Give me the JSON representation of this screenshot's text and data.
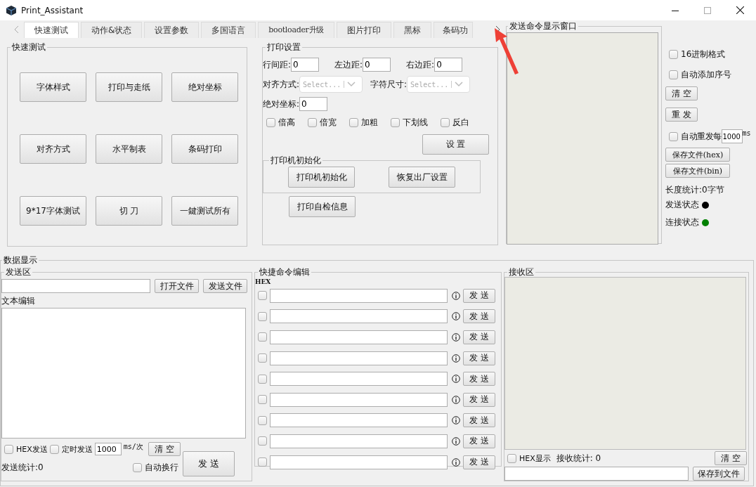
{
  "window": {
    "title": "Print_Assistant"
  },
  "tabs": [
    {
      "label": "快速测试",
      "selected": true
    },
    {
      "label": "动作&状态",
      "selected": false
    },
    {
      "label": "设置参数",
      "selected": false
    },
    {
      "label": "多国语言",
      "selected": false
    },
    {
      "label": "bootloader升级",
      "selected": false
    },
    {
      "label": "图片打印",
      "selected": false
    },
    {
      "label": "黑标",
      "selected": false
    },
    {
      "label": "条码功",
      "selected": false
    }
  ],
  "quick_test": {
    "title": "快速测试",
    "buttons": [
      "字体样式",
      "打印与走纸",
      "绝对坐标",
      "对齐方式",
      "水平制表",
      "条码打印",
      "9*17字体测试",
      "切 刀",
      "一鍵测试所有"
    ]
  },
  "print_settings": {
    "title": "打印设置",
    "margins": [
      {
        "label": "行间距:",
        "value": "0"
      },
      {
        "label": "左边距:",
        "value": "0"
      },
      {
        "label": "右边距:",
        "value": "0"
      }
    ],
    "selects": [
      {
        "label": "对齐方式:",
        "placeholder": "Select..."
      },
      {
        "label": "字符尺寸:",
        "placeholder": "Select..."
      }
    ],
    "abs_position": {
      "label": "绝对坐标:",
      "value": "0"
    },
    "options": [
      {
        "label": "倍高",
        "checked": false
      },
      {
        "label": "倍宽",
        "checked": false
      },
      {
        "label": "加粗",
        "checked": false
      },
      {
        "label": "下划线",
        "checked": false
      },
      {
        "label": "反白",
        "checked": false
      }
    ],
    "set_button": "设 置",
    "init_group": {
      "title": "打印机初始化",
      "buttons": [
        "打印机初始化",
        "恢复出厂设置"
      ]
    },
    "self_test_button": "打印自检信息"
  },
  "command_window": {
    "title": "发送命令显示窗口"
  },
  "command_options": {
    "checkboxes": [
      {
        "label": "16进制格式",
        "checked": false
      },
      {
        "label": "自动添加序号",
        "checked": false
      }
    ],
    "clear_button": "清 空",
    "resend_button": "重 发",
    "auto_resend": {
      "label": "自动重发每",
      "checked": false,
      "value": "1000",
      "unit": "ms"
    },
    "save_buttons": [
      "保存文件(hex)",
      "保存文件(bin)"
    ],
    "length_stat": "长度统计:0字节",
    "statuses": [
      {
        "label": "发送状态",
        "color": "#000000"
      },
      {
        "label": "连接状态",
        "color": "#008000"
      }
    ]
  },
  "data_display": {
    "title": "数据显示",
    "send_area": {
      "title": "发送区",
      "open_button": "打开文件",
      "send_file_button": "发送文件",
      "editor_label": "文本编辑",
      "hex_send": {
        "label": "HEX发送",
        "checked": false
      },
      "timed_send": {
        "label": "定时发送",
        "checked": false,
        "value": "1000",
        "unit": "ms/次"
      },
      "clear_button": "清 空",
      "send_button": "发 送",
      "send_stat": "发送统计:0",
      "auto_wrap": {
        "label": "自动换行",
        "checked": false
      }
    },
    "quick_commands": {
      "title": "快捷命令编辑",
      "hex_header": "HEX",
      "rows": [
        {
          "checked": false,
          "button": "发 送"
        },
        {
          "checked": false,
          "button": "发 送"
        },
        {
          "checked": false,
          "button": "发 送"
        },
        {
          "checked": false,
          "button": "发 送"
        },
        {
          "checked": false,
          "button": "发 送"
        },
        {
          "checked": false,
          "button": "发 送"
        },
        {
          "checked": false,
          "button": "发 送"
        },
        {
          "checked": false,
          "button": "发 送"
        },
        {
          "checked": false,
          "button": "发 送"
        }
      ]
    },
    "receive_area": {
      "title": "接收区",
      "hex_display": {
        "label": "HEX显示",
        "checked": false
      },
      "receive_stat": "接收统计: 0",
      "clear_button": "清 空",
      "save_button": "保存到文件"
    }
  }
}
